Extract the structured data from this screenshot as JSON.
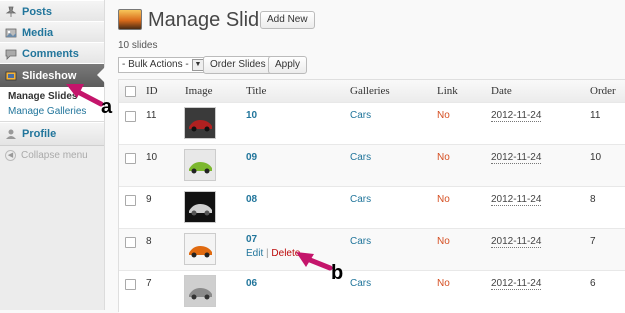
{
  "sidebar": {
    "items": [
      {
        "label": "Posts",
        "icon": "pushpin-icon"
      },
      {
        "label": "Media",
        "icon": "media-icon"
      },
      {
        "label": "Comments",
        "icon": "comment-icon"
      },
      {
        "label": "Slideshow",
        "icon": "slideshow-icon"
      },
      {
        "label": "Profile",
        "icon": "profile-icon"
      }
    ],
    "submenu": [
      {
        "label": "Manage Slides"
      },
      {
        "label": "Manage Galleries"
      }
    ],
    "collapse_label": "Collapse menu"
  },
  "header": {
    "title": "Manage Slides",
    "add_new_label": "Add New",
    "count_text": "10 slides"
  },
  "toolbar": {
    "bulk_actions": "- Bulk Actions -",
    "order_slides_label": "Order Slides",
    "apply_label": "Apply"
  },
  "table": {
    "columns": [
      "ID",
      "Image",
      "Title",
      "Galleries",
      "Link",
      "Date",
      "Order"
    ],
    "rows": [
      {
        "id": "11",
        "title": "10",
        "gallery": "Cars",
        "link": "No",
        "date": "2012-11-24",
        "order": "11",
        "thumb_color": "#b02020"
      },
      {
        "id": "10",
        "title": "09",
        "gallery": "Cars",
        "link": "No",
        "date": "2012-11-24",
        "order": "10",
        "thumb_color": "#7cb82f"
      },
      {
        "id": "9",
        "title": "08",
        "gallery": "Cars",
        "link": "No",
        "date": "2012-11-24",
        "order": "8",
        "thumb_color": "#d0d0d0"
      },
      {
        "id": "8",
        "title": "07",
        "gallery": "Cars",
        "link": "No",
        "date": "2012-11-24",
        "order": "7",
        "thumb_color": "#e06a10"
      },
      {
        "id": "7",
        "title": "06",
        "gallery": "Cars",
        "link": "No",
        "date": "2012-11-24",
        "order": "6",
        "thumb_color": "#9a9a9a"
      }
    ],
    "row_actions": {
      "edit": "Edit",
      "separator": "|",
      "delete": "Delete"
    }
  },
  "annotations": {
    "a": "a",
    "b": "b"
  },
  "colors": {
    "accent": "#21759b",
    "delete": "#bc0b0b",
    "arrow": "#c4156b",
    "no_link": "#d54e21"
  }
}
